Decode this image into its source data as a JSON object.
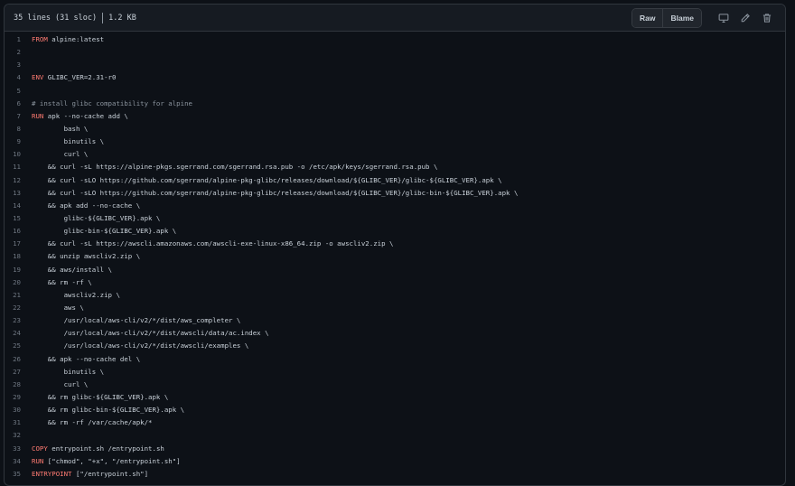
{
  "header": {
    "lines_info": "35 lines (31 sloc)",
    "size_info": "1.2 KB",
    "raw_label": "Raw",
    "blame_label": "Blame"
  },
  "icons": {
    "display": "desktop-icon",
    "edit": "pencil-icon",
    "delete": "trash-icon"
  },
  "colors": {
    "background": "#0d1117",
    "keyword": "#ff7b72",
    "comment": "#8b949e",
    "text": "#c9d1d9",
    "line_number": "#6e7681"
  },
  "code": [
    {
      "n": "1",
      "kw": "FROM",
      "text": " alpine:latest"
    },
    {
      "n": "2",
      "kw": "",
      "text": ""
    },
    {
      "n": "3",
      "kw": "",
      "text": ""
    },
    {
      "n": "4",
      "kw": "ENV",
      "text": " GLIBC_VER=2.31-r0"
    },
    {
      "n": "5",
      "kw": "",
      "text": ""
    },
    {
      "n": "6",
      "kw": "",
      "comment": "# install glibc compatibility for alpine",
      "text": ""
    },
    {
      "n": "7",
      "kw": "RUN",
      "text": " apk --no-cache add \\"
    },
    {
      "n": "8",
      "kw": "",
      "text": "        bash \\"
    },
    {
      "n": "9",
      "kw": "",
      "text": "        binutils \\"
    },
    {
      "n": "10",
      "kw": "",
      "text": "        curl \\"
    },
    {
      "n": "11",
      "kw": "",
      "text": "    && curl -sL https://alpine-pkgs.sgerrand.com/sgerrand.rsa.pub -o /etc/apk/keys/sgerrand.rsa.pub \\"
    },
    {
      "n": "12",
      "kw": "",
      "text": "    && curl -sLO https://github.com/sgerrand/alpine-pkg-glibc/releases/download/${GLIBC_VER}/glibc-${GLIBC_VER}.apk \\"
    },
    {
      "n": "13",
      "kw": "",
      "text": "    && curl -sLO https://github.com/sgerrand/alpine-pkg-glibc/releases/download/${GLIBC_VER}/glibc-bin-${GLIBC_VER}.apk \\"
    },
    {
      "n": "14",
      "kw": "",
      "text": "    && apk add --no-cache \\"
    },
    {
      "n": "15",
      "kw": "",
      "text": "        glibc-${GLIBC_VER}.apk \\"
    },
    {
      "n": "16",
      "kw": "",
      "text": "        glibc-bin-${GLIBC_VER}.apk \\"
    },
    {
      "n": "17",
      "kw": "",
      "text": "    && curl -sL https://awscli.amazonaws.com/awscli-exe-linux-x86_64.zip -o awscliv2.zip \\"
    },
    {
      "n": "18",
      "kw": "",
      "text": "    && unzip awscliv2.zip \\"
    },
    {
      "n": "19",
      "kw": "",
      "text": "    && aws/install \\"
    },
    {
      "n": "20",
      "kw": "",
      "text": "    && rm -rf \\"
    },
    {
      "n": "21",
      "kw": "",
      "text": "        awscliv2.zip \\"
    },
    {
      "n": "22",
      "kw": "",
      "text": "        aws \\"
    },
    {
      "n": "23",
      "kw": "",
      "text": "        /usr/local/aws-cli/v2/*/dist/aws_completer \\"
    },
    {
      "n": "24",
      "kw": "",
      "text": "        /usr/local/aws-cli/v2/*/dist/awscli/data/ac.index \\"
    },
    {
      "n": "25",
      "kw": "",
      "text": "        /usr/local/aws-cli/v2/*/dist/awscli/examples \\"
    },
    {
      "n": "26",
      "kw": "",
      "text": "    && apk --no-cache del \\"
    },
    {
      "n": "27",
      "kw": "",
      "text": "        binutils \\"
    },
    {
      "n": "28",
      "kw": "",
      "text": "        curl \\"
    },
    {
      "n": "29",
      "kw": "",
      "text": "    && rm glibc-${GLIBC_VER}.apk \\"
    },
    {
      "n": "30",
      "kw": "",
      "text": "    && rm glibc-bin-${GLIBC_VER}.apk \\"
    },
    {
      "n": "31",
      "kw": "",
      "text": "    && rm -rf /var/cache/apk/*"
    },
    {
      "n": "32",
      "kw": "",
      "text": ""
    },
    {
      "n": "33",
      "kw": "COPY",
      "text": " entrypoint.sh /entrypoint.sh"
    },
    {
      "n": "34",
      "kw": "RUN",
      "text": " [\"chmod\", \"+x\", \"/entrypoint.sh\"]"
    },
    {
      "n": "35",
      "kw": "ENTRYPOINT",
      "text": " [\"/entrypoint.sh\"]"
    }
  ]
}
